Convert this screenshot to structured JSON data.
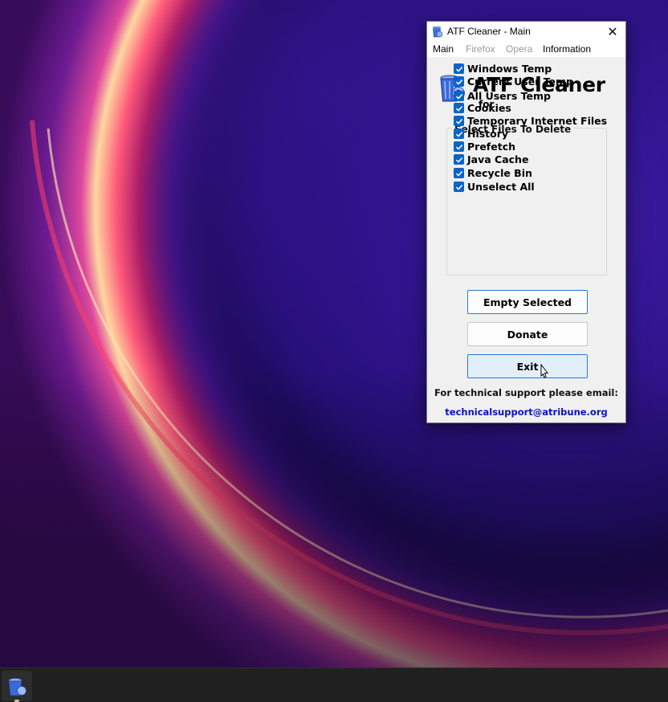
{
  "window": {
    "title": "ATF Cleaner - Main",
    "close_glyph": "✕",
    "menu": [
      "Main",
      "Firefox",
      "Opera",
      "Information"
    ],
    "menu_disabled": [
      false,
      true,
      true,
      false
    ]
  },
  "logo": {
    "title": "ATF Cleaner",
    "subtitle": "for",
    "icon": "recycle-bin-icon"
  },
  "group": {
    "legend": "Select Files To Delete",
    "items": [
      {
        "label": "Windows Temp",
        "checked": true
      },
      {
        "label": "Current User Temp",
        "checked": true
      },
      {
        "label": "All Users Temp",
        "checked": true
      },
      {
        "label": "Cookies",
        "checked": true
      },
      {
        "label": "Temporary Internet Files",
        "checked": true
      },
      {
        "label": "History",
        "checked": true
      },
      {
        "label": "Prefetch",
        "checked": true
      },
      {
        "label": "Java Cache",
        "checked": true
      },
      {
        "label": "Recycle Bin",
        "checked": true
      },
      {
        "label": "Unselect All",
        "checked": true
      }
    ]
  },
  "buttons": {
    "empty": "Empty Selected",
    "donate": "Donate",
    "exit": "Exit"
  },
  "support": {
    "text": "For technical support please email:",
    "email": "technicalsupport@atribune.org"
  },
  "colors": {
    "checkbox": "#0a64c8",
    "email": "#0a10c8",
    "button_focus_border": "#2a78d8"
  },
  "taskbar": {
    "app_icon": "atf-cleaner-icon"
  }
}
